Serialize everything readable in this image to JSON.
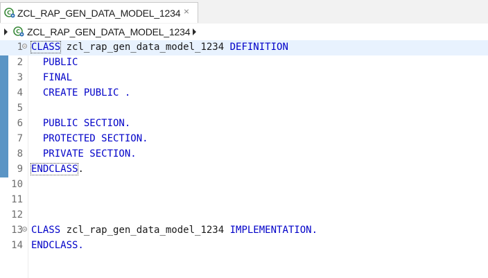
{
  "tab": {
    "label": "ZCL_RAP_GEN_DATA_MODEL_1234",
    "close_glyph": "⨯",
    "icon": "abap-class-icon"
  },
  "breadcrumb": {
    "label": "ZCL_RAP_GEN_DATA_MODEL_1234",
    "icon": "abap-class-icon"
  },
  "colors": {
    "keyword": "#0000c8",
    "current_line": "#e8f2fe",
    "quick_diff": "#5b95c5"
  },
  "editor": {
    "lines": [
      {
        "num": "1",
        "kw1": "CLASS",
        "txt": " zcl_rap_gen_data_model_1234 ",
        "kw2": "DEFINITION"
      },
      {
        "num": "2",
        "kw1": "  PUBLIC",
        "txt": "",
        "kw2": ""
      },
      {
        "num": "3",
        "kw1": "  FINAL",
        "txt": "",
        "kw2": ""
      },
      {
        "num": "4",
        "kw1": "  CREATE PUBLIC .",
        "txt": "",
        "kw2": ""
      },
      {
        "num": "5",
        "kw1": "",
        "txt": "",
        "kw2": ""
      },
      {
        "num": "6",
        "kw1": "  PUBLIC SECTION.",
        "txt": "",
        "kw2": ""
      },
      {
        "num": "7",
        "kw1": "  PROTECTED SECTION.",
        "txt": "",
        "kw2": ""
      },
      {
        "num": "8",
        "kw1": "  PRIVATE SECTION.",
        "txt": "",
        "kw2": ""
      },
      {
        "num": "9",
        "kw1": "ENDCLASS",
        "txt": ".",
        "kw2": ""
      },
      {
        "num": "10",
        "kw1": "",
        "txt": "",
        "kw2": ""
      },
      {
        "num": "11",
        "kw1": "",
        "txt": "",
        "kw2": ""
      },
      {
        "num": "12",
        "kw1": "",
        "txt": "",
        "kw2": ""
      },
      {
        "num": "13",
        "kw1": "CLASS",
        "txt": " zcl_rap_gen_data_model_1234 ",
        "kw2": "IMPLEMENTATION."
      },
      {
        "num": "14",
        "kw1": "ENDCLASS.",
        "txt": "",
        "kw2": ""
      }
    ]
  }
}
